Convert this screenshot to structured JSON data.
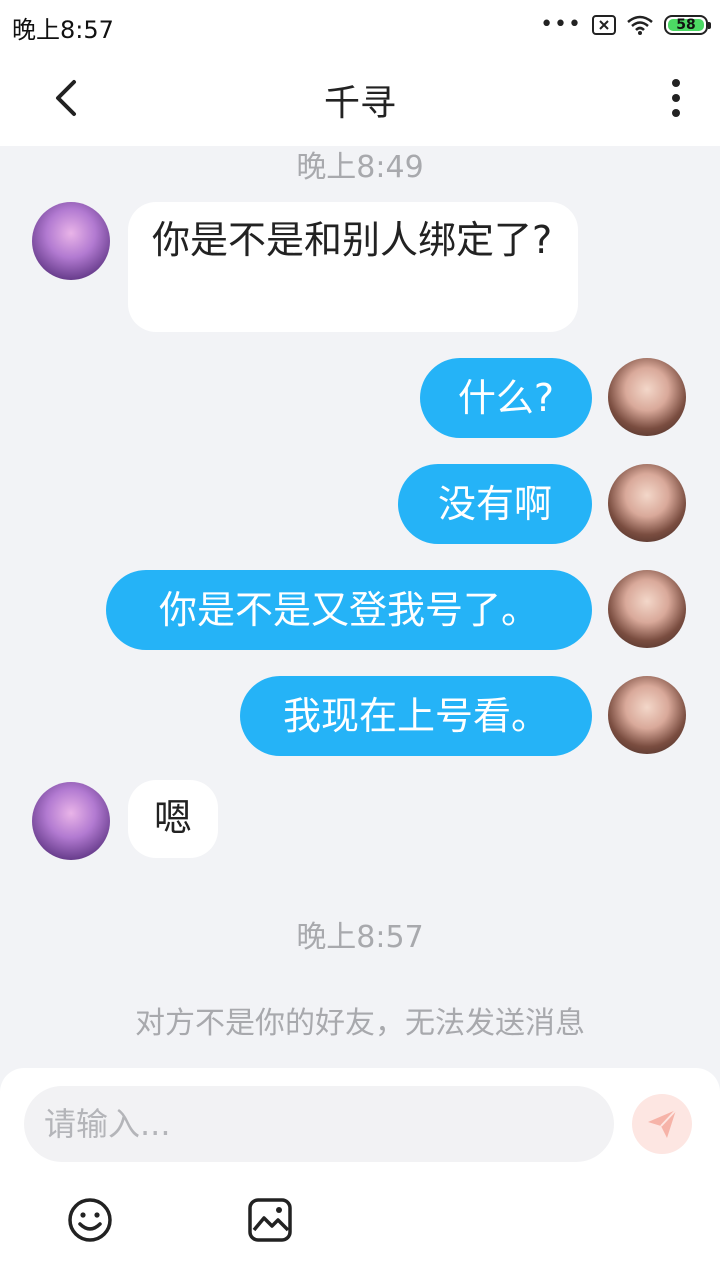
{
  "status_bar": {
    "time": "晚上8:57",
    "battery": "58"
  },
  "header": {
    "title": "千寻"
  },
  "messages": {
    "time_1": "晚上8:49",
    "m1": "你是不是和别人绑定了?",
    "m2": "什么?",
    "m3": "没有啊",
    "m4": "你是不是又登我号了。",
    "m5": "我现在上号看。",
    "m6": "嗯",
    "time_2": "晚上8:57"
  },
  "notice": "对方不是你的好友，无法发送消息",
  "input": {
    "placeholder": "请输入..."
  },
  "icons": {
    "back": "chevron-left-icon",
    "more": "more-vertical-icon",
    "send": "send-icon",
    "emoji": "smiley-icon",
    "image": "image-icon"
  },
  "colors": {
    "accent": "#25b3f7",
    "send_disabled": "#fde6e2"
  }
}
